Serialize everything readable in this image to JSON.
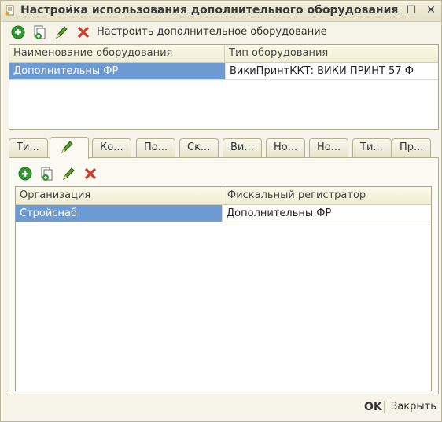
{
  "window": {
    "title": "Настройка использования дополнительного оборудования",
    "maximize_glyph": "☐",
    "close_glyph": "✕"
  },
  "toolbar1": {
    "icons": [
      "add-icon",
      "copy-icon",
      "edit-icon",
      "delete-icon"
    ],
    "configure_label": "Настроить дополнительное оборудование"
  },
  "equipment_table": {
    "columns": [
      "Наименование оборудования",
      "Тип оборудования"
    ],
    "rows": [
      [
        "Дополнительны ФР",
        "ВикиПринтККТ: ВИКИ ПРИНТ 57 Ф"
      ]
    ]
  },
  "tabs": [
    {
      "label": "Ти..."
    },
    {
      "label": "",
      "icon": "edit-icon"
    },
    {
      "label": "Ко..."
    },
    {
      "label": "По..."
    },
    {
      "label": "Ск..."
    },
    {
      "label": "Ви..."
    },
    {
      "label": "Но..."
    },
    {
      "label": "Но..."
    },
    {
      "label": "Ти..."
    },
    {
      "label": "Пр..."
    }
  ],
  "toolbar2": {
    "icons": [
      "add-icon",
      "copy-icon",
      "edit-icon",
      "delete-icon"
    ]
  },
  "org_table": {
    "columns": [
      "Организация",
      "Фискальный регистратор"
    ],
    "rows": [
      [
        "Стройснаб",
        "Дополнительны ФР"
      ]
    ]
  },
  "footer": {
    "ok_label": "OK",
    "close_label": "Закрыть"
  },
  "colors": {
    "selection": "#6e9ad4",
    "window_bg": "#f6f4e8",
    "add_green": "#2f9a2f",
    "delete_red": "#d33a2a"
  }
}
